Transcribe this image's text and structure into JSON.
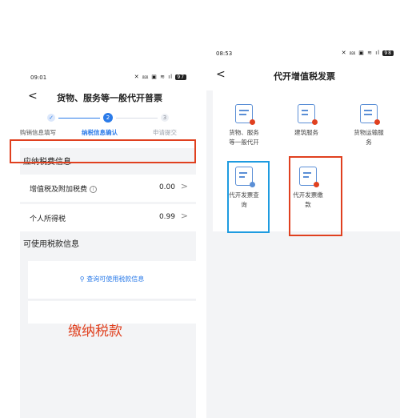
{
  "left": {
    "status_time": "09:01",
    "status_icons": "✕ ⅏ ▣ ≋ ıl",
    "battery": "97",
    "back": "<",
    "title": "货物、服务等一般代开普票",
    "steps": [
      {
        "marker": "✓",
        "label": "购销信息填写"
      },
      {
        "marker": "2",
        "label": "纳税信息确认"
      },
      {
        "marker": "3",
        "label": "申请提交"
      }
    ],
    "section1_title": "应纳税费信息",
    "rows": [
      {
        "label": "增值税及附加税费",
        "info": "i",
        "value": "0.00",
        "chevron": ">"
      },
      {
        "label": "个人所得税",
        "value": "0.99",
        "chevron": ">"
      }
    ],
    "section2_title": "可使用税款信息",
    "query_text": "查询可使用税款信息",
    "annotation": "缴纳税款"
  },
  "right": {
    "status_time": "08:53",
    "status_icons": "✕ ⅏ ▣ ≋ ıl",
    "battery": "98",
    "back": "<",
    "title": "代开增值税发票",
    "tiles": [
      {
        "line1": "货物、服务",
        "line2": "等一般代开"
      },
      {
        "line1": "建筑服务",
        "line2": ""
      },
      {
        "line1": "货物运输服",
        "line2": "务"
      },
      {
        "line1": "代开发票查",
        "line2": "询"
      },
      {
        "line1": "代开发票缴",
        "line2": "款"
      }
    ]
  },
  "colors": {
    "accent": "#2b7be9",
    "highlight_red": "#e0401f",
    "highlight_blue": "#1e9be0",
    "background_gray": "#f3f4f6"
  }
}
